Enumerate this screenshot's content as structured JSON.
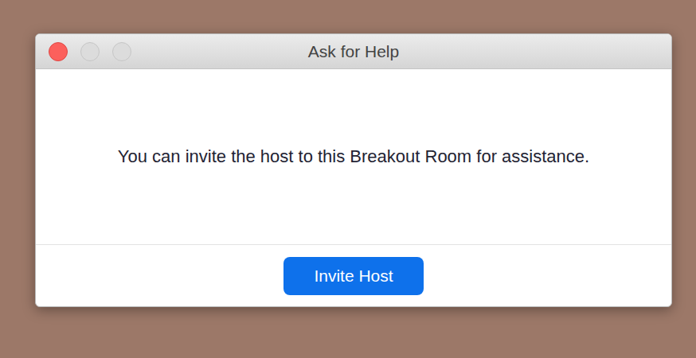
{
  "window": {
    "title": "Ask for Help"
  },
  "message": "You can invite the host to this Breakout Room for assistance.",
  "buttons": [
    {
      "label": "Invite Host",
      "primary": true
    }
  ]
}
